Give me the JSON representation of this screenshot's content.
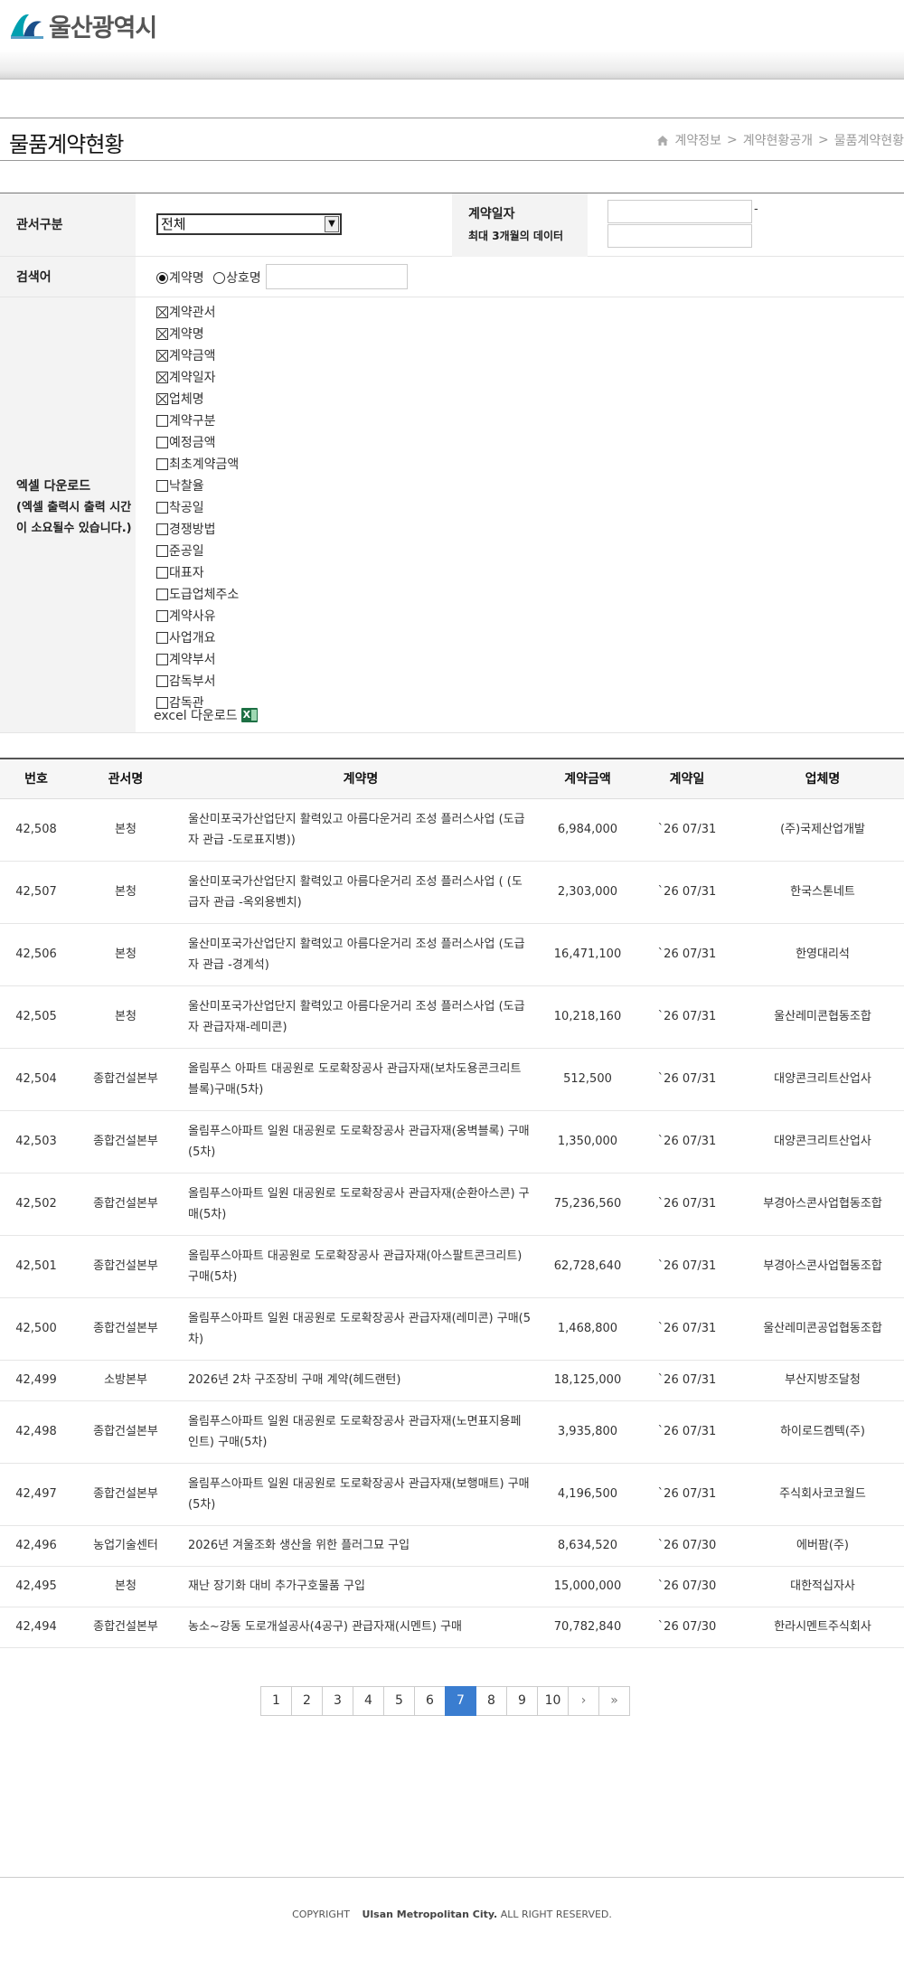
{
  "header": {
    "logo_text": "울산광역시"
  },
  "title": "물품계약현황",
  "breadcrumb": [
    "계약정보",
    "계약현황공개",
    "물품계약현황"
  ],
  "form": {
    "agency_label": "관서구분",
    "agency_selected": "전체",
    "date_label": "계약일자",
    "date_note": "최대 3개월의 데이터",
    "date_sep": "-",
    "keyword_label": "검색어",
    "radio_options": [
      "계약명",
      "상호명"
    ],
    "excel_label_1": "엑셀 다운로드",
    "excel_label_2": "(엑셀 출력시 출력 시간",
    "excel_label_3": "이 소요될수 있습니다.)",
    "checkbox_items": [
      {
        "label": "계약관서",
        "checked": true
      },
      {
        "label": "계약명",
        "checked": true
      },
      {
        "label": "계약금액",
        "checked": true
      },
      {
        "label": "계약일자",
        "checked": true
      },
      {
        "label": "업체명",
        "checked": true
      },
      {
        "label": "계약구분",
        "checked": false
      },
      {
        "label": "예정금액",
        "checked": false
      },
      {
        "label": "최초계약금액",
        "checked": false
      },
      {
        "label": "낙찰율",
        "checked": false
      },
      {
        "label": "착공일",
        "checked": false
      },
      {
        "label": "경쟁방법",
        "checked": false
      },
      {
        "label": "준공일",
        "checked": false
      },
      {
        "label": "대표자",
        "checked": false
      },
      {
        "label": "도급업체주소",
        "checked": false
      },
      {
        "label": "계약사유",
        "checked": false
      },
      {
        "label": "사업개요",
        "checked": false
      },
      {
        "label": "계약부서",
        "checked": false
      },
      {
        "label": "감독부서",
        "checked": false
      },
      {
        "label": "감독관",
        "checked": false
      }
    ],
    "excel_download_text": "excel 다운로드"
  },
  "table": {
    "headers": [
      "번호",
      "관서명",
      "계약명",
      "계약금액",
      "계약일",
      "업체명"
    ],
    "rows": [
      {
        "no": "42,508",
        "agency": "본청",
        "name": "울산미포국가산업단지 활력있고 아름다운거리 조성 플러스사업 (도급자 관급 -도로표지병))",
        "amount": "6,984,000",
        "date": "`26 07/31",
        "company": "(주)국제산업개발"
      },
      {
        "no": "42,507",
        "agency": "본청",
        "name": "울산미포국가산업단지 활력있고 아름다운거리 조성 플러스사업 ( (도급자 관급 -옥외용벤치)",
        "amount": "2,303,000",
        "date": "`26 07/31",
        "company": "한국스톤네트"
      },
      {
        "no": "42,506",
        "agency": "본청",
        "name": "울산미포국가산업단지 활력있고 아름다운거리 조성 플러스사업 (도급자 관급 -경계석)",
        "amount": "16,471,100",
        "date": "`26 07/31",
        "company": "한영대리석"
      },
      {
        "no": "42,505",
        "agency": "본청",
        "name": "울산미포국가산업단지 활력있고 아름다운거리 조성 플러스사업 (도급자 관급자재-레미콘)",
        "amount": "10,218,160",
        "date": "`26 07/31",
        "company": "울산레미콘협동조합"
      },
      {
        "no": "42,504",
        "agency": "종합건설본부",
        "name": "올림푸스 아파트 대공원로 도로확장공사 관급자재(보차도용콘크리트블록)구매(5차)",
        "amount": "512,500",
        "date": "`26 07/31",
        "company": "대양콘크리트산업사"
      },
      {
        "no": "42,503",
        "agency": "종합건설본부",
        "name": "올림푸스아파트 일원 대공원로 도로확장공사 관급자재(옹벽블록) 구매(5차)",
        "amount": "1,350,000",
        "date": "`26 07/31",
        "company": "대양콘크리트산업사"
      },
      {
        "no": "42,502",
        "agency": "종합건설본부",
        "name": "올림푸스아파트 일원 대공원로 도로확장공사 관급자재(순환아스콘) 구매(5차)",
        "amount": "75,236,560",
        "date": "`26 07/31",
        "company": "부경아스콘사업협동조합"
      },
      {
        "no": "42,501",
        "agency": "종합건설본부",
        "name": "올림푸스아파트 대공원로 도로확장공사 관급자재(아스팔트콘크리트)구매(5차)",
        "amount": "62,728,640",
        "date": "`26 07/31",
        "company": "부경아스콘사업협동조합"
      },
      {
        "no": "42,500",
        "agency": "종합건설본부",
        "name": "올림푸스아파트 일원 대공원로 도로확장공사 관급자재(레미콘) 구매(5차)",
        "amount": "1,468,800",
        "date": "`26 07/31",
        "company": "울산레미콘공업협동조합"
      },
      {
        "no": "42,499",
        "agency": "소방본부",
        "name": "2026년 2차 구조장비 구매 계약(헤드랜턴)",
        "amount": "18,125,000",
        "date": "`26 07/31",
        "company": "부산지방조달청"
      },
      {
        "no": "42,498",
        "agency": "종합건설본부",
        "name": "올림푸스아파트 일원 대공원로 도로확장공사 관급자재(노면표지용페인트) 구매(5차)",
        "amount": "3,935,800",
        "date": "`26 07/31",
        "company": "하이로드켐텍(주)"
      },
      {
        "no": "42,497",
        "agency": "종합건설본부",
        "name": "올림푸스아파트 일원 대공원로 도로확장공사 관급자재(보행매트) 구매(5차)",
        "amount": "4,196,500",
        "date": "`26 07/31",
        "company": "주식회사코코월드"
      },
      {
        "no": "42,496",
        "agency": "농업기술센터",
        "name": "2026년 겨울조화 생산을 위한 플러그묘 구입",
        "amount": "8,634,520",
        "date": "`26 07/30",
        "company": "에버팜(주)"
      },
      {
        "no": "42,495",
        "agency": "본청",
        "name": "재난 장기화 대비 추가구호물품 구입",
        "amount": "15,000,000",
        "date": "`26 07/30",
        "company": "대한적십자사"
      },
      {
        "no": "42,494",
        "agency": "종합건설본부",
        "name": "농소~강동 도로개설공사(4공구) 관급자재(시멘트) 구매",
        "amount": "70,782,840",
        "date": "`26 07/30",
        "company": "한라시멘트주식회사"
      }
    ]
  },
  "pagination": {
    "pages": [
      "1",
      "2",
      "3",
      "4",
      "5",
      "6",
      "7",
      "8",
      "9",
      "10"
    ],
    "current": "7",
    "next": "›",
    "last": "»"
  },
  "footer": {
    "copyright": "COPYRIGHT",
    "city": "Ulsan Metropolitan City.",
    "rights": "ALL RIGHT RESERVED."
  },
  "colors": {
    "active_page": "#3a7dd0",
    "label_bg": "#f3f3f3",
    "excel_green": "#1d7044"
  },
  "icons": [
    "home-icon",
    "dropdown-arrow-icon",
    "excel-icon"
  ]
}
